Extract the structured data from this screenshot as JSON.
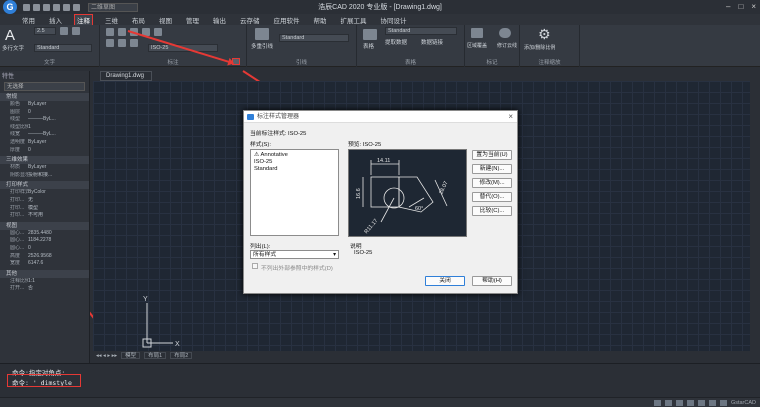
{
  "app": {
    "title": "浩辰CAD 2020 专业版 - [Drawing1.dwg]",
    "logo_letter": "G",
    "quick_combo": "二维草图",
    "window_controls": [
      "–",
      "□",
      "×"
    ]
  },
  "menu": [
    "常用",
    "插入",
    "注释",
    "三维",
    "布局",
    "视图",
    "管理",
    "输出",
    "云存储",
    "应用软件",
    "帮助",
    "扩展工具",
    "协同设计"
  ],
  "ribbon": {
    "text_style_label": "多行文字",
    "text_style_value": "Standard",
    "text_height": "2.5",
    "dim_style_value": "ISO-25",
    "multileader_label": "多重引线",
    "mleader_value": "Standard",
    "table_label": "表格",
    "table_style_value": "Standard",
    "extract_label": "提取数据",
    "link_label": "数据链接",
    "revision_label": "修订云线",
    "region_label": "区域覆盖",
    "scale_label": "添加/删除比例",
    "panels": [
      "文字",
      "标注",
      "引线",
      "表格",
      "标记",
      "注释缩放"
    ]
  },
  "document_tab": "Drawing1.dwg",
  "properties": {
    "title": "特性",
    "selection": "无选择",
    "sections": [
      {
        "name": "常规",
        "rows": [
          [
            "颜色",
            "ByLayer"
          ],
          [
            "图层",
            "0"
          ],
          [
            "线型",
            "———ByL..."
          ],
          [
            "线型比例",
            "1"
          ],
          [
            "线宽",
            "———ByL..."
          ],
          [
            "透明度",
            "ByLayer"
          ],
          [
            "厚度",
            "0"
          ]
        ]
      },
      {
        "name": "三维效果",
        "rows": [
          [
            "材质",
            "ByLayer"
          ],
          [
            "阴影显示",
            "投射和接..."
          ]
        ]
      },
      {
        "name": "打印样式",
        "rows": [
          [
            "打印样式",
            "ByColor"
          ],
          [
            "打印...",
            "无"
          ],
          [
            "打印...",
            "模型"
          ],
          [
            "打印...",
            "不可用"
          ]
        ]
      },
      {
        "name": "视图",
        "rows": [
          [
            "圆心...",
            "2835.4480"
          ],
          [
            "圆心...",
            "1184.2278"
          ],
          [
            "圆心...",
            "0"
          ],
          [
            "高度",
            "2526.9568"
          ],
          [
            "宽度",
            "6147.6"
          ]
        ]
      },
      {
        "name": "其他",
        "rows": [
          [
            "注释比例",
            "1:1"
          ],
          [
            "打开...",
            "否"
          ]
        ]
      }
    ]
  },
  "layout_tabs": [
    "模型",
    "布局1",
    "布局2"
  ],
  "command": {
    "line1": "命令:指定对角点:",
    "line2": "命令: '_dimstyle"
  },
  "status": {
    "brand": "GstarCAD"
  },
  "dialog": {
    "title": "标注样式管理器",
    "current_style_label": "当前标注样式: ISO-25",
    "styles_label": "样式(S):",
    "styles": [
      "Annotative",
      "ISO-25",
      "Standard"
    ],
    "preview_label": "预览: ISO-25",
    "list_label": "列出(L):",
    "list_value": "所有样式",
    "xref_checkbox": "不列出外部参照中的样式(D)",
    "description_label": "说明",
    "description_value": "ISO-25",
    "buttons": [
      "置为当前(U)",
      "新建(N)...",
      "修改(M)...",
      "替代(O)...",
      "比较(C)..."
    ],
    "close": "关闭",
    "help": "帮助(H)",
    "preview_dims": [
      "14.11",
      "16.6",
      "28.07",
      "60°",
      "R11.17"
    ]
  },
  "canvas": {
    "ucs_y": "Y",
    "ucs_x": "X"
  }
}
